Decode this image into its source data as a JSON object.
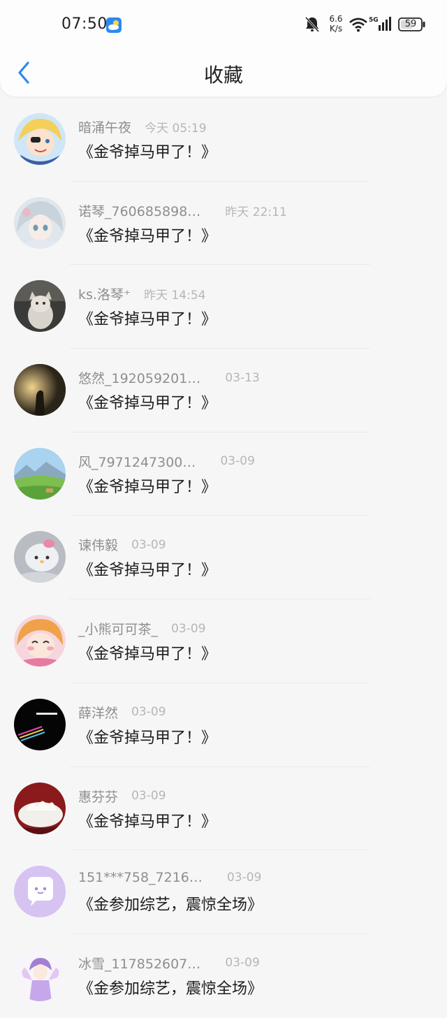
{
  "status_bar": {
    "time": "07:50",
    "net_speed_top": "6.6",
    "net_speed_bottom": "K/s",
    "battery": "59",
    "icons": [
      "weather-icon",
      "bell-muted-icon",
      "wifi-icon",
      "5g-signal-icon",
      "battery-icon"
    ]
  },
  "header": {
    "title": "收藏",
    "back_icon": "chevron-left-icon"
  },
  "colors": {
    "accent": "#2a8af0",
    "background": "#f6f6f7",
    "username": "#8e8e8e",
    "timestamp": "#b6b6b6",
    "title_text": "#1c1c1c"
  },
  "items": [
    {
      "username": "暗涌午夜",
      "time": "今天 05:19",
      "title": "《金爷掉马甲了！》",
      "avatar": "anime-avatar-blonde-boy"
    },
    {
      "username": "诺琴_760685898…",
      "time": "昨天 22:11",
      "title": "《金爷掉马甲了！》",
      "avatar": "anime-avatar-silver-hair"
    },
    {
      "username": "ks.洛琴⁺",
      "time": "昨天 14:54",
      "title": "《金爷掉马甲了！》",
      "avatar": "cat-photo-avatar"
    },
    {
      "username": "悠然_192059201…",
      "time": "03-13",
      "title": "《金爷掉马甲了！》",
      "avatar": "sunset-photo-avatar"
    },
    {
      "username": "风_7971247300…",
      "time": "03-09",
      "title": "《金爷掉马甲了！》",
      "avatar": "landscape-avatar"
    },
    {
      "username": "谏伟毅",
      "time": "03-09",
      "title": "《金爷掉马甲了！》",
      "avatar": "hello-kitty-avatar"
    },
    {
      "username": "_小熊可可茶_",
      "time": "03-09",
      "title": "《金爷掉马甲了！》",
      "avatar": "anime-avatar-orange-hair"
    },
    {
      "username": "薛洋然",
      "time": "03-09",
      "title": "《金爷掉马甲了！》",
      "avatar": "dark-text-avatar"
    },
    {
      "username": "惠芬芬",
      "time": "03-09",
      "title": "《金爷掉马甲了！》",
      "avatar": "cream-cake-avatar"
    },
    {
      "username": "151***758_7216…",
      "time": "03-09",
      "title": "《金参加综艺，震惊全场》",
      "avatar": "default-chat-avatar"
    },
    {
      "username": "冰雪_117852607…",
      "time": "03-09",
      "title": "《金参加综艺，震惊全场》",
      "avatar": "anime-avatar-fairy"
    }
  ]
}
